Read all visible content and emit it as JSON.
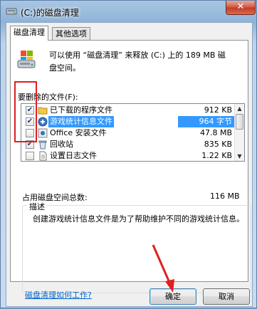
{
  "window": {
    "title": "(C:)的磁盘清理",
    "close_glyph": "✕"
  },
  "tabs": [
    {
      "label": "磁盘清理",
      "active": true
    },
    {
      "label": "其他选项",
      "active": false
    }
  ],
  "intro": {
    "line1": "可以使用 “磁盘清理” 来释放  (C:) 上的 189 MB 磁",
    "line2": "盘空间。"
  },
  "files_to_delete_label": "要删除的文件(F):",
  "files": [
    {
      "name": "已下载的程序文件",
      "size": "912 KB",
      "checked": true,
      "selected": false,
      "icon": "folder-icon"
    },
    {
      "name": "游戏统计信息文件",
      "size": "964 字节",
      "checked": true,
      "selected": true,
      "icon": "game-stats-icon"
    },
    {
      "name": "Office 安装文件",
      "size": "47.8 MB",
      "checked": false,
      "selected": false,
      "icon": "office-icon"
    },
    {
      "name": "回收站",
      "size": "835 KB",
      "checked": true,
      "selected": false,
      "icon": "recycle-bin-icon"
    },
    {
      "name": "设置日志文件",
      "size": "1.22 KB",
      "checked": false,
      "selected": false,
      "icon": "document-icon"
    }
  ],
  "total": {
    "label": "占用磁盘空间总数:",
    "value": "116 MB"
  },
  "description": {
    "legend": "描述",
    "text": "创建游戏统计信息文件是为了帮助维护不同的游戏统计信息。"
  },
  "help_link": "磁盘清理如何工作?",
  "buttons": {
    "ok": "确定",
    "cancel": "取消"
  },
  "colors": {
    "selection": "#3399ff",
    "annotation_red": "#e01f1f",
    "link": "#0066cc"
  }
}
